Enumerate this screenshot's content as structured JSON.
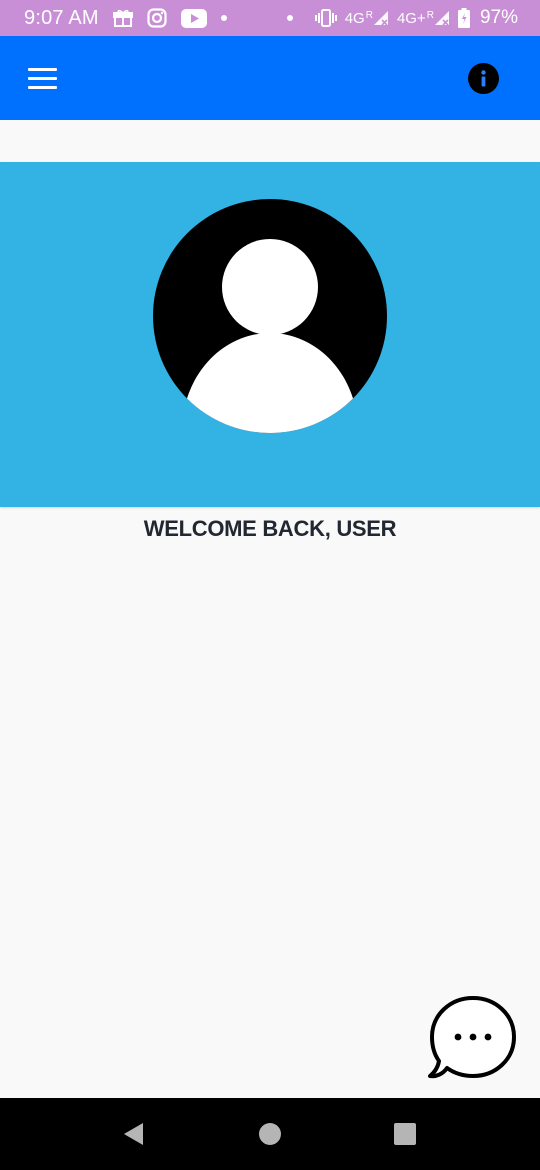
{
  "status_bar": {
    "time": "9:07 AM",
    "network_1": "4G",
    "network_1_roaming": "R",
    "network_2": "4G+",
    "network_2_roaming": "R",
    "battery": "97%"
  },
  "app_bar": {
    "background_color": "#0070ff",
    "menu_icon": "hamburger-menu-icon",
    "info_icon": "info-icon"
  },
  "profile": {
    "banner_color": "#33b3e4",
    "avatar_icon": "user-avatar-icon",
    "welcome_text": "WELCOME BACK, USER"
  },
  "chat": {
    "icon": "chat-bubble-icon"
  },
  "nav_bar": {
    "back_icon": "back-triangle-icon",
    "home_icon": "home-circle-icon",
    "recent_icon": "recents-square-icon"
  }
}
